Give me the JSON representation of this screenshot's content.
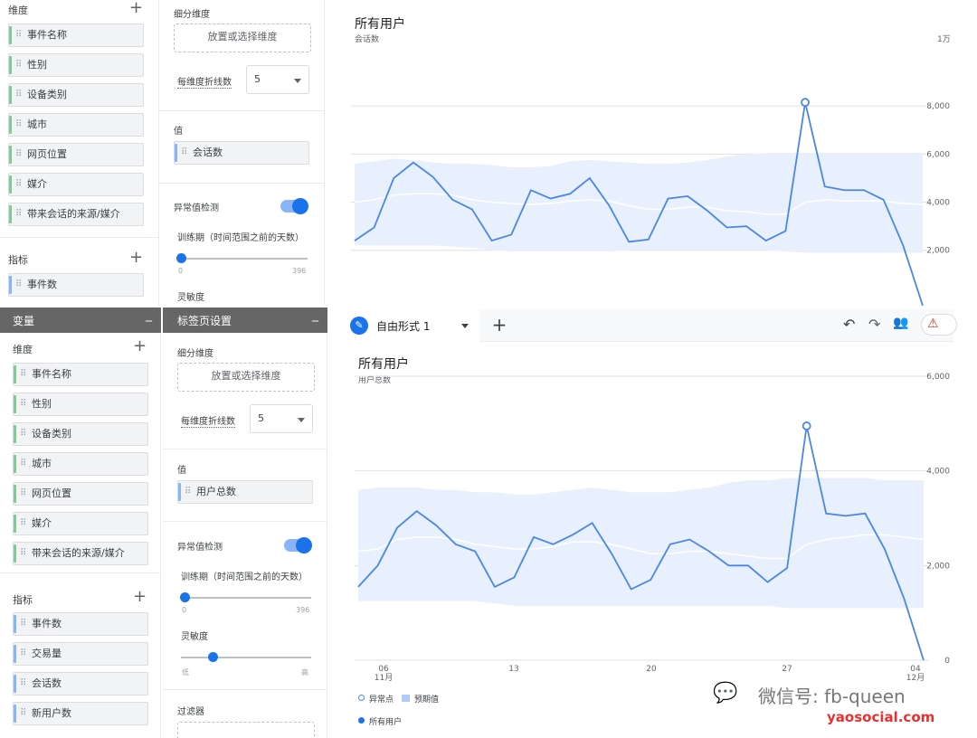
{
  "top_panel": {
    "dims_title": "维度",
    "dimensions": [
      "事件名称",
      "性别",
      "设备类别",
      "城市",
      "网页位置",
      "媒介",
      "带来会话的来源/媒介"
    ],
    "metrics_title": "指标",
    "metrics": [
      "事件数"
    ],
    "breakdown_title": "细分维度",
    "breakdown_drop": "放置或选择维度",
    "lines_label": "每维度折线数",
    "lines_value": "5",
    "values_title": "值",
    "value_chip": "会话数",
    "anomaly_label": "异常值检测",
    "training_label": "训练期（时间范围之前的天数）",
    "training_min": "0",
    "training_max": "396",
    "sensitivity_label": "灵敏度"
  },
  "bottom_panel": {
    "variables_header": "变量",
    "tab_settings_header": "标签页设置",
    "dims_title": "维度",
    "dimensions": [
      "事件名称",
      "性别",
      "设备类别",
      "城市",
      "网页位置",
      "媒介",
      "带来会话的来源/媒介"
    ],
    "metrics_title": "指标",
    "metrics": [
      "事件数",
      "交易量",
      "会话数",
      "新用户数"
    ],
    "breakdown_title": "细分维度",
    "breakdown_drop": "放置或选择维度",
    "lines_label": "每维度折线数",
    "lines_value": "5",
    "values_title": "值",
    "value_chip": "用户总数",
    "anomaly_label": "异常值检测",
    "training_label": "训练期（时间范围之前的天数）",
    "training_min": "0",
    "training_max": "396",
    "sensitivity_label": "灵敏度",
    "sens_low": "低",
    "sens_high": "高",
    "filter_title": "过滤器"
  },
  "tabbar": {
    "tab_label": "自由形式 1",
    "add_label": "+"
  },
  "legend": {
    "anomaly": "异常点",
    "expected": "预期值",
    "series": "所有用户"
  },
  "watermark": {
    "wechat": "微信号: fb-queen",
    "site": "yaosocial.com"
  },
  "colors": {
    "line": "#4a86e8",
    "band": "#e8f0fe",
    "accent": "#1a73e8",
    "site": "#e8312e"
  },
  "chart_data": [
    {
      "type": "line",
      "title": "所有用户",
      "ylabel": "会话数",
      "unit_label": "1万",
      "yticks": [
        "8,000",
        "6,000",
        "4,000",
        "2,000"
      ],
      "ylim": [
        1200,
        10000
      ],
      "x": [
        1,
        2,
        3,
        4,
        5,
        6,
        7,
        8,
        9,
        10,
        11,
        12,
        13,
        14,
        15,
        16,
        17,
        18,
        19,
        20,
        21,
        22,
        23,
        24,
        25,
        26,
        27,
        28,
        29,
        30
      ],
      "series": [
        {
          "name": "所有用户",
          "values": [
            2400,
            2950,
            5000,
            5650,
            5050,
            4100,
            3700,
            2400,
            2650,
            4500,
            4150,
            4350,
            5000,
            3850,
            2350,
            2450,
            4150,
            4250,
            3650,
            2950,
            3000,
            2400,
            2800,
            8150,
            4650,
            4500,
            4500,
            4100,
            2200,
            -300
          ]
        },
        {
          "name": "预期值",
          "values": [
            4000,
            4100,
            4300,
            4350,
            4350,
            4300,
            4100,
            4000,
            3950,
            3900,
            3950,
            4050,
            4100,
            4050,
            3850,
            3700,
            3700,
            3800,
            3800,
            3650,
            3600,
            3500,
            3500,
            4000,
            4100,
            4050,
            4050,
            4050,
            3950,
            3900
          ]
        }
      ],
      "band_upper": [
        5600,
        5700,
        5800,
        5750,
        5650,
        5600,
        5600,
        5550,
        5450,
        5450,
        5500,
        5700,
        5750,
        5700,
        5650,
        5600,
        5600,
        5650,
        5750,
        5900,
        6000,
        6050,
        6050,
        6050,
        6050,
        6050,
        6050,
        6050,
        6050,
        6050
      ],
      "band_lower": [
        2200,
        2200,
        2200,
        2200,
        2200,
        2150,
        2100,
        2000,
        1950,
        1950,
        1950,
        1950,
        1950,
        1950,
        2000,
        2000,
        2000,
        2000,
        2000,
        2000,
        2000,
        2000,
        1950,
        1900,
        1900,
        1900,
        1900,
        1900,
        1900,
        1900
      ],
      "anomaly_index": 23
    },
    {
      "type": "line",
      "title": "所有用户",
      "ylabel": "用户总数",
      "yticks": [
        "6,000",
        "4,000",
        "2,000",
        "0"
      ],
      "ylim": [
        0,
        6000
      ],
      "x_labels": [
        "06\n11月",
        "13",
        "20",
        "27",
        "04\n12月"
      ],
      "x": [
        1,
        2,
        3,
        4,
        5,
        6,
        7,
        8,
        9,
        10,
        11,
        12,
        13,
        14,
        15,
        16,
        17,
        18,
        19,
        20,
        21,
        22,
        23,
        24,
        25,
        26,
        27,
        28,
        29,
        30
      ],
      "series": [
        {
          "name": "所有用户",
          "values": [
            1550,
            2000,
            2800,
            3150,
            2850,
            2450,
            2300,
            1550,
            1750,
            2600,
            2450,
            2650,
            2900,
            2250,
            1500,
            1700,
            2450,
            2550,
            2300,
            2000,
            2000,
            1650,
            1950,
            4950,
            3100,
            3050,
            3100,
            2350,
            1300,
            0
          ]
        },
        {
          "name": "预期值",
          "values": [
            2300,
            2350,
            2550,
            2600,
            2600,
            2550,
            2450,
            2400,
            2350,
            2350,
            2400,
            2500,
            2500,
            2450,
            2350,
            2250,
            2250,
            2300,
            2300,
            2250,
            2200,
            2150,
            2150,
            2450,
            2550,
            2600,
            2650,
            2650,
            2600,
            2550
          ]
        }
      ],
      "band_upper": [
        3600,
        3650,
        3650,
        3650,
        3600,
        3600,
        3550,
        3550,
        3500,
        3500,
        3550,
        3600,
        3650,
        3600,
        3550,
        3550,
        3550,
        3600,
        3650,
        3750,
        3800,
        3800,
        3850,
        3850,
        3850,
        3850,
        3850,
        3800,
        3800,
        3800
      ],
      "band_lower": [
        1250,
        1250,
        1250,
        1250,
        1250,
        1250,
        1250,
        1200,
        1150,
        1150,
        1150,
        1150,
        1150,
        1150,
        1150,
        1150,
        1150,
        1150,
        1150,
        1150,
        1150,
        1150,
        1100,
        1100,
        1100,
        1100,
        1100,
        1100,
        1100,
        1100
      ],
      "anomaly_index": 23
    }
  ]
}
